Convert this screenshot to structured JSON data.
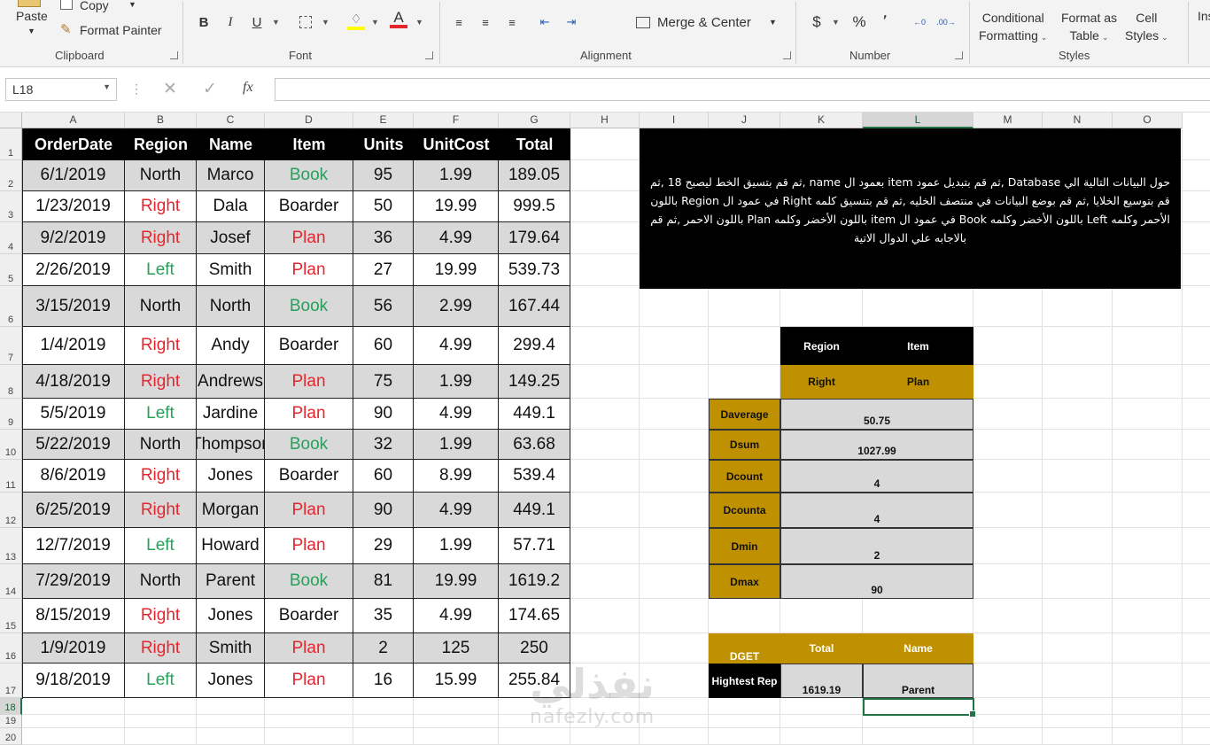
{
  "ribbon": {
    "clipboard": {
      "paste": "Paste",
      "copy": "Copy",
      "format_painter": "Format Painter",
      "label": "Clipboard"
    },
    "font": {
      "label": "Font",
      "bold": "B",
      "italic": "I",
      "underline": "U"
    },
    "alignment": {
      "label": "Alignment",
      "merge_center": "Merge & Center"
    },
    "number": {
      "label": "Number",
      "currency": "$",
      "percent": "%",
      "comma": "٬"
    },
    "styles": {
      "label": "Styles",
      "conditional_1": "Conditional",
      "conditional_2": "Formatting",
      "format_table_1": "Format as",
      "format_table_2": "Table",
      "cell_styles_1": "Cell",
      "cell_styles_2": "Styles",
      "insert_partial": "Ins"
    },
    "accent": "#217346"
  },
  "formula_bar": {
    "name_box": "L18",
    "fx": "fx",
    "value": ""
  },
  "columns": [
    "A",
    "B",
    "C",
    "D",
    "E",
    "F",
    "G",
    "H",
    "I",
    "J",
    "K",
    "L",
    "M",
    "N",
    "O"
  ],
  "rows": [
    "1",
    "2",
    "3",
    "4",
    "5",
    "6",
    "7",
    "8",
    "9",
    "10",
    "11",
    "12",
    "13",
    "14",
    "15",
    "16",
    "17",
    "18",
    "19",
    "20"
  ],
  "table": {
    "headers": [
      "OrderDate",
      "Region",
      "Name",
      "Item",
      "Units",
      "UnitCost",
      "Total"
    ],
    "rows": [
      [
        "6/1/2019",
        "North",
        "Marco",
        "Book",
        "95",
        "1.99",
        "189.05"
      ],
      [
        "1/23/2019",
        "Right",
        "Dala",
        "Boarder",
        "50",
        "19.99",
        "999.5"
      ],
      [
        "9/2/2019",
        "Right",
        "Josef",
        "Plan",
        "36",
        "4.99",
        "179.64"
      ],
      [
        "2/26/2019",
        "Left",
        "Smith",
        "Plan",
        "27",
        "19.99",
        "539.73"
      ],
      [
        "3/15/2019",
        "North",
        "North",
        "Book",
        "56",
        "2.99",
        "167.44"
      ],
      [
        "1/4/2019",
        "Right",
        "Andy",
        "Boarder",
        "60",
        "4.99",
        "299.4"
      ],
      [
        "4/18/2019",
        "Right",
        "Andrews",
        "Plan",
        "75",
        "1.99",
        "149.25"
      ],
      [
        "5/5/2019",
        "Left",
        "Jardine",
        "Plan",
        "90",
        "4.99",
        "449.1"
      ],
      [
        "5/22/2019",
        "North",
        "Thompson",
        "Book",
        "32",
        "1.99",
        "63.68"
      ],
      [
        "8/6/2019",
        "Right",
        "Jones",
        "Boarder",
        "60",
        "8.99",
        "539.4"
      ],
      [
        "6/25/2019",
        "Right",
        "Morgan",
        "Plan",
        "90",
        "4.99",
        "449.1"
      ],
      [
        "12/7/2019",
        "Left",
        "Howard",
        "Plan",
        "29",
        "1.99",
        "57.71"
      ],
      [
        "7/29/2019",
        "North",
        "Parent",
        "Book",
        "81",
        "19.99",
        "1619.2"
      ],
      [
        "8/15/2019",
        "Right",
        "Jones",
        "Boarder",
        "35",
        "4.99",
        "174.65"
      ],
      [
        "1/9/2019",
        "Right",
        "Smith",
        "Plan",
        "2",
        "125",
        "250"
      ],
      [
        "9/18/2019",
        "Left",
        "Jones",
        "Plan",
        "16",
        "15.99",
        "255.84"
      ]
    ]
  },
  "instructions": "حول البيانات التالية الي Database ,ثم قم بتبديل عمود item بعمود ال name ,ثم قم بتسيق الخط ليصبح 18 ,ثم قم بتوسيع الخلايا ,ثم قم بوضع البيانات في منتصف الخليه ,ثم قم بتنسيق كلمه Right في عمود ال Region باللون الأحمر وكلمه Left باللون الأخضر وكلمه Book في عمود ال item باللون الأخضر وكلمه Plan باللون الاحمر ,ثم قم بالاجابه علي الدوال الاتية",
  "criteria": {
    "h1": "Region",
    "h2": "Item",
    "v1": "Right",
    "v2": "Plan"
  },
  "functions": [
    {
      "name": "Daverage",
      "value": "50.75"
    },
    {
      "name": "Dsum",
      "value": "1027.99"
    },
    {
      "name": "Dcount",
      "value": "4"
    },
    {
      "name": "Dcounta",
      "value": "4"
    },
    {
      "name": "Dmin",
      "value": "2"
    },
    {
      "name": "Dmax",
      "value": "90"
    }
  ],
  "dget": {
    "label": "DGET",
    "h1": "Total",
    "h2": "Name",
    "row_label": "Hightest Rep",
    "v1": "1619.19",
    "v2": "Parent"
  },
  "watermark": {
    "line1": "نفذلي",
    "line2": "nafezly.com"
  },
  "colors": {
    "red": "#e5262e",
    "green": "#27a05a",
    "gold": "#bf9000",
    "grey": "#d9d9d9"
  }
}
